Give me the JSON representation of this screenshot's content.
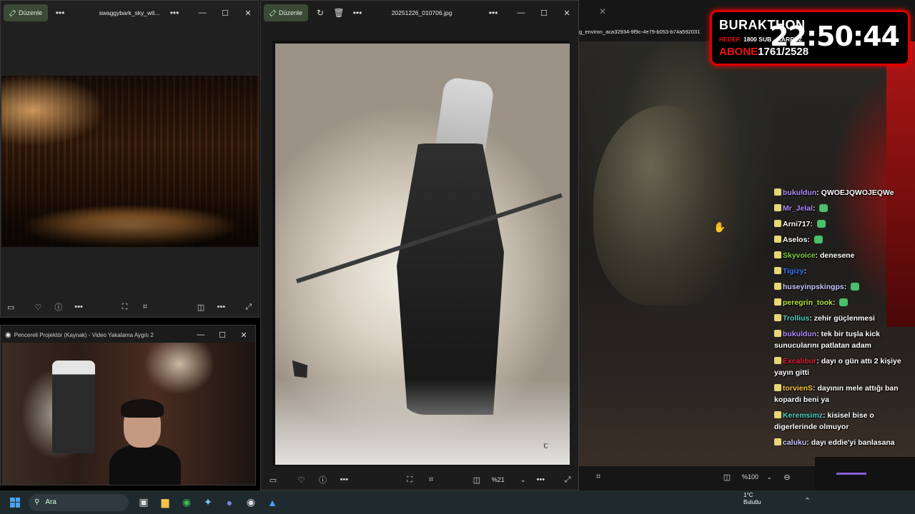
{
  "window1": {
    "edit_label": "Düzenle",
    "title": "swaggybark_sky_wit...",
    "more": "•••"
  },
  "window2": {
    "title": "Pencereli Projektör (Kaynak) - Video Yakalama Aygıtı 2"
  },
  "window3": {
    "edit_label": "Düzenle",
    "title": "20251226_010706.jpg",
    "zoom": "%21",
    "signature": "ꞇ"
  },
  "window4": {
    "file_path": "g_environ_aca32934-9f9c-4e79-b053-b74a592031",
    "zoom": "%100"
  },
  "overlay": {
    "name": "BURAKTHON",
    "hedef_label": "HEDEF:",
    "hedef_value": " 1800 SUB - KARPUZ",
    "abone_label": "ABONE",
    "abone_value": "1761/2528",
    "time": "22:50:44"
  },
  "chat": [
    {
      "user": "bukuldun",
      "color": "#b48cff",
      "text": "QWOEJQWOJEQWe",
      "emote": false
    },
    {
      "user": "Mr_Jelal",
      "color": "#b48cff",
      "text": "",
      "emote": true
    },
    {
      "user": "Arni717",
      "color": "#ffffff",
      "text": "",
      "emote": true
    },
    {
      "user": "Aselos",
      "color": "#ffffff",
      "text": "",
      "emote": true
    },
    {
      "user": "Skyvoice",
      "color": "#7dd63c",
      "text": "denesene",
      "emote": false
    },
    {
      "user": "Tigizy",
      "color": "#3a7bff",
      "text": "",
      "emote": false
    },
    {
      "user": "huseyinpskingps",
      "color": "#c9c9ff",
      "text": "",
      "emote": true
    },
    {
      "user": "peregrin_took",
      "color": "#b6e63a",
      "text": "",
      "emote": true
    },
    {
      "user": "Trollius",
      "color": "#4fd1c5",
      "text": "zehir güçlenmesi",
      "emote": false
    },
    {
      "user": "bukuldun",
      "color": "#b48cff",
      "text": "tek bir tuşla kick sunucularını patlatan adam",
      "emote": false
    },
    {
      "user": "Excalibur",
      "color": "#e0223a",
      "text": "dayı o gün attı 2 kişiye yayın gitti",
      "emote": false
    },
    {
      "user": "torvienS",
      "color": "#ffc43d",
      "text": "dayının mele attığı ban kopardı beni ya",
      "emote": false
    },
    {
      "user": "Keremsimz",
      "color": "#4fd1c5",
      "text": "kisisel bise o digerlerinde olmuyor",
      "emote": false
    },
    {
      "user": "caluku",
      "color": "#c9c9ff",
      "text": "dayı eddie'yi banlasana",
      "emote": false
    }
  ],
  "taskbar": {
    "search_placeholder": "Ara",
    "temperature": "1°C",
    "weather": "Bulutlu"
  }
}
